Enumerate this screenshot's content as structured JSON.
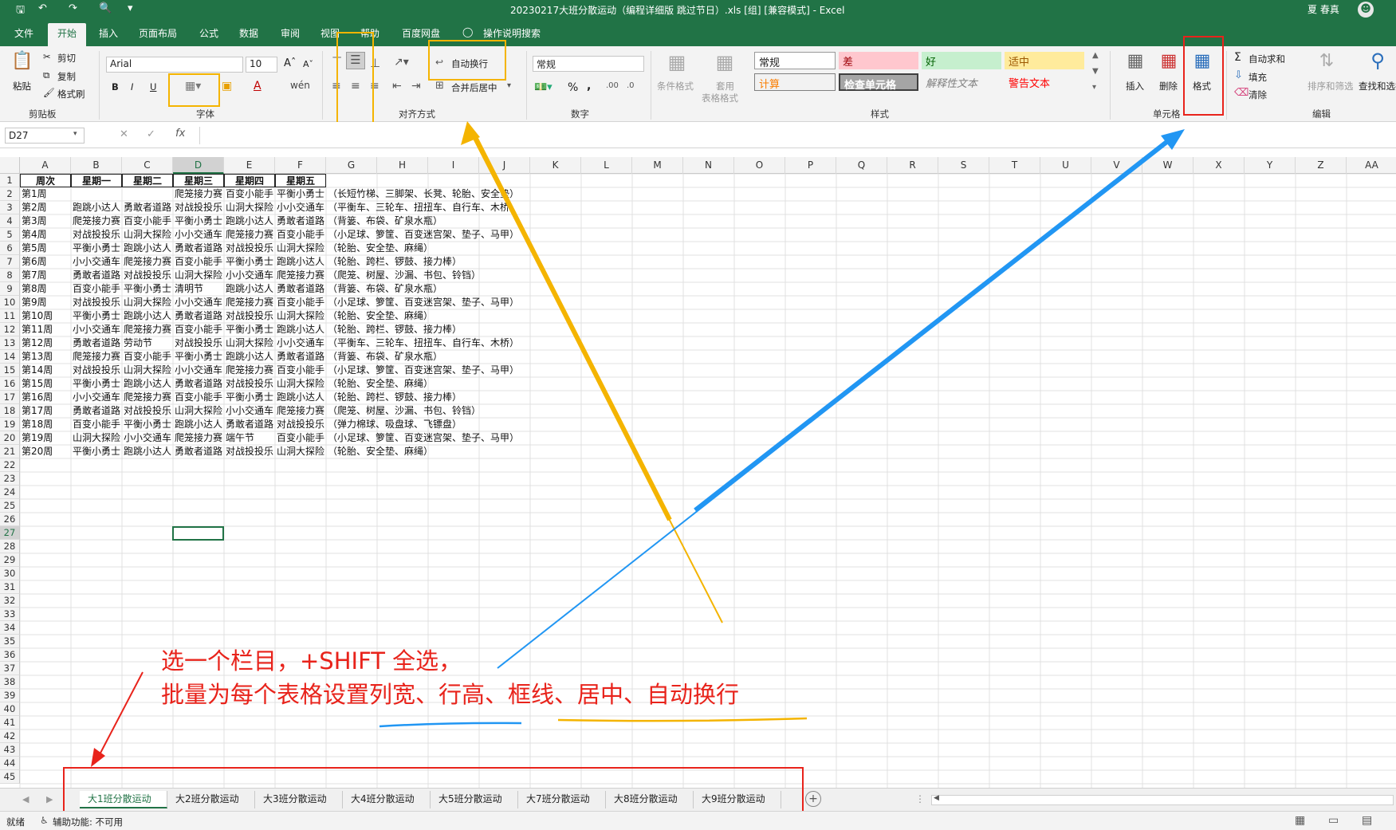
{
  "titlebar": {
    "title": "20230217大班分散运动（编程详细版 跳过节日）.xls [组] [兼容模式] - Excel",
    "user": "夏 春真",
    "undo_icon": "undo-icon",
    "save_icon": "save-icon"
  },
  "tabs": [
    "文件",
    "开始",
    "插入",
    "页面布局",
    "公式",
    "数据",
    "审阅",
    "视图",
    "帮助",
    "百度网盘"
  ],
  "tell_me": "操作说明搜索",
  "ribbon": {
    "clipboard": {
      "paste": "粘贴",
      "cut": "剪切",
      "copy": "复制",
      "format_painter": "格式刷",
      "label": "剪贴板"
    },
    "font": {
      "name": "Arial",
      "size": "10",
      "bold": "B",
      "italic": "I",
      "underline": "U",
      "label": "字体"
    },
    "align": {
      "wrap": "自动换行",
      "merge": "合并后居中",
      "label": "对齐方式"
    },
    "number": {
      "format": "常规",
      "percent": "%",
      "comma": ",",
      "label": "数字"
    },
    "styles": {
      "cond": "条件格式",
      "table": "套用\n表格格式",
      "table_l1": "套用",
      "table_l2": "表格格式",
      "normal": "常规",
      "bad": "差",
      "good": "好",
      "neutral": "适中",
      "calc": "计算",
      "check": "检查单元格",
      "explain": "解释性文本",
      "warn": "警告文本",
      "label": "样式"
    },
    "cells": {
      "insert": "插入",
      "delete": "删除",
      "format": "格式",
      "label": "单元格"
    },
    "editing": {
      "autosum": "自动求和",
      "fill": "填充",
      "clear": "清除",
      "sort": "排序和筛选",
      "find": "查找和选择",
      "label": "编辑"
    }
  },
  "formula_bar": {
    "namebox": "D27",
    "fx": "fx",
    "value": ""
  },
  "columns": [
    "A",
    "B",
    "C",
    "D",
    "E",
    "F",
    "G",
    "H",
    "I",
    "J",
    "K",
    "L",
    "M",
    "N",
    "O",
    "P",
    "Q",
    "R",
    "S",
    "T",
    "U",
    "V",
    "W",
    "X",
    "Y",
    "Z",
    "AA"
  ],
  "headers": [
    "周次",
    "星期一",
    "星期二",
    "星期三",
    "星期四",
    "星期五"
  ],
  "rows": [
    [
      "第1周",
      "",
      "",
      "爬笼接力赛",
      "百变小能手",
      "平衡小勇士",
      "（长短竹梯、三脚架、长凳、轮胎、安全垫）"
    ],
    [
      "第2周",
      "跑跳小达人",
      "勇敢者道路",
      "对战投投乐",
      "山洞大探险",
      "小小交通车",
      "（平衡车、三轮车、扭扭车、自行车、木桥）"
    ],
    [
      "第3周",
      "爬笼接力赛",
      "百变小能手",
      "平衡小勇士",
      "跑跳小达人",
      "勇敢者道路",
      "（背篓、布袋、矿泉水瓶）"
    ],
    [
      "第4周",
      "对战投投乐",
      "山洞大探险",
      "小小交通车",
      "爬笼接力赛",
      "百变小能手",
      "（小足球、箩筐、百变迷宫架、垫子、马甲）"
    ],
    [
      "第5周",
      "平衡小勇士",
      "跑跳小达人",
      "勇敢者道路",
      "对战投投乐",
      "山洞大探险",
      "（轮胎、安全垫、麻绳）"
    ],
    [
      "第6周",
      "小小交通车",
      "爬笼接力赛",
      "百变小能手",
      "平衡小勇士",
      "跑跳小达人",
      "（轮胎、跨栏、锣鼓、接力棒）"
    ],
    [
      "第7周",
      "勇敢者道路",
      "对战投投乐",
      "山洞大探险",
      "小小交通车",
      "爬笼接力赛",
      "（爬笼、树屋、沙漏、书包、铃铛）"
    ],
    [
      "第8周",
      "百变小能手",
      "平衡小勇士",
      "清明节",
      "跑跳小达人",
      "勇敢者道路",
      "（背篓、布袋、矿泉水瓶）"
    ],
    [
      "第9周",
      "对战投投乐",
      "山洞大探险",
      "小小交通车",
      "爬笼接力赛",
      "百变小能手",
      "（小足球、箩筐、百变迷宫架、垫子、马甲）"
    ],
    [
      "第10周",
      "平衡小勇士",
      "跑跳小达人",
      "勇敢者道路",
      "对战投投乐",
      "山洞大探险",
      "（轮胎、安全垫、麻绳）"
    ],
    [
      "第11周",
      "小小交通车",
      "爬笼接力赛",
      "百变小能手",
      "平衡小勇士",
      "跑跳小达人",
      "（轮胎、跨栏、锣鼓、接力棒）"
    ],
    [
      "第12周",
      "勇敢者道路",
      "劳动节",
      "对战投投乐",
      "山洞大探险",
      "小小交通车",
      "（平衡车、三轮车、扭扭车、自行车、木桥）"
    ],
    [
      "第13周",
      "爬笼接力赛",
      "百变小能手",
      "平衡小勇士",
      "跑跳小达人",
      "勇敢者道路",
      "（背篓、布袋、矿泉水瓶）"
    ],
    [
      "第14周",
      "对战投投乐",
      "山洞大探险",
      "小小交通车",
      "爬笼接力赛",
      "百变小能手",
      "（小足球、箩筐、百变迷宫架、垫子、马甲）"
    ],
    [
      "第15周",
      "平衡小勇士",
      "跑跳小达人",
      "勇敢者道路",
      "对战投投乐",
      "山洞大探险",
      "（轮胎、安全垫、麻绳）"
    ],
    [
      "第16周",
      "小小交通车",
      "爬笼接力赛",
      "百变小能手",
      "平衡小勇士",
      "跑跳小达人",
      "（轮胎、跨栏、锣鼓、接力棒）"
    ],
    [
      "第17周",
      "勇敢者道路",
      "对战投投乐",
      "山洞大探险",
      "小小交通车",
      "爬笼接力赛",
      "（爬笼、树屋、沙漏、书包、铃铛）"
    ],
    [
      "第18周",
      "百变小能手",
      "平衡小勇士",
      "跑跳小达人",
      "勇敢者道路",
      "对战投投乐",
      "（弹力棉球、吸盘球、飞镖盘）"
    ],
    [
      "第19周",
      "山洞大探险",
      "小小交通车",
      "爬笼接力赛",
      "端午节",
      "百变小能手",
      "（小足球、箩筐、百变迷宫架、垫子、马甲）"
    ],
    [
      "第20周",
      "平衡小勇士",
      "跑跳小达人",
      "勇敢者道路",
      "对战投投乐",
      "山洞大探险",
      "（轮胎、安全垫、麻绳）"
    ]
  ],
  "sheets": [
    "大1班分散运动",
    "大2班分散运动",
    "大3班分散运动",
    "大4班分散运动",
    "大5班分散运动",
    "大7班分散运动",
    "大8班分散运动",
    "大9班分散运动"
  ],
  "status": {
    "ready": "就绪",
    "accessibility": "辅助功能: 不可用"
  },
  "annotation": {
    "line1": "选一个栏目，+SHIFT 全选，",
    "line2": "批量为每个表格设置列宽、行高、框线、居中、自动换行",
    "colors": {
      "red": "#e8231b",
      "yellow": "#f4b400",
      "blue": "#2196f3"
    }
  }
}
